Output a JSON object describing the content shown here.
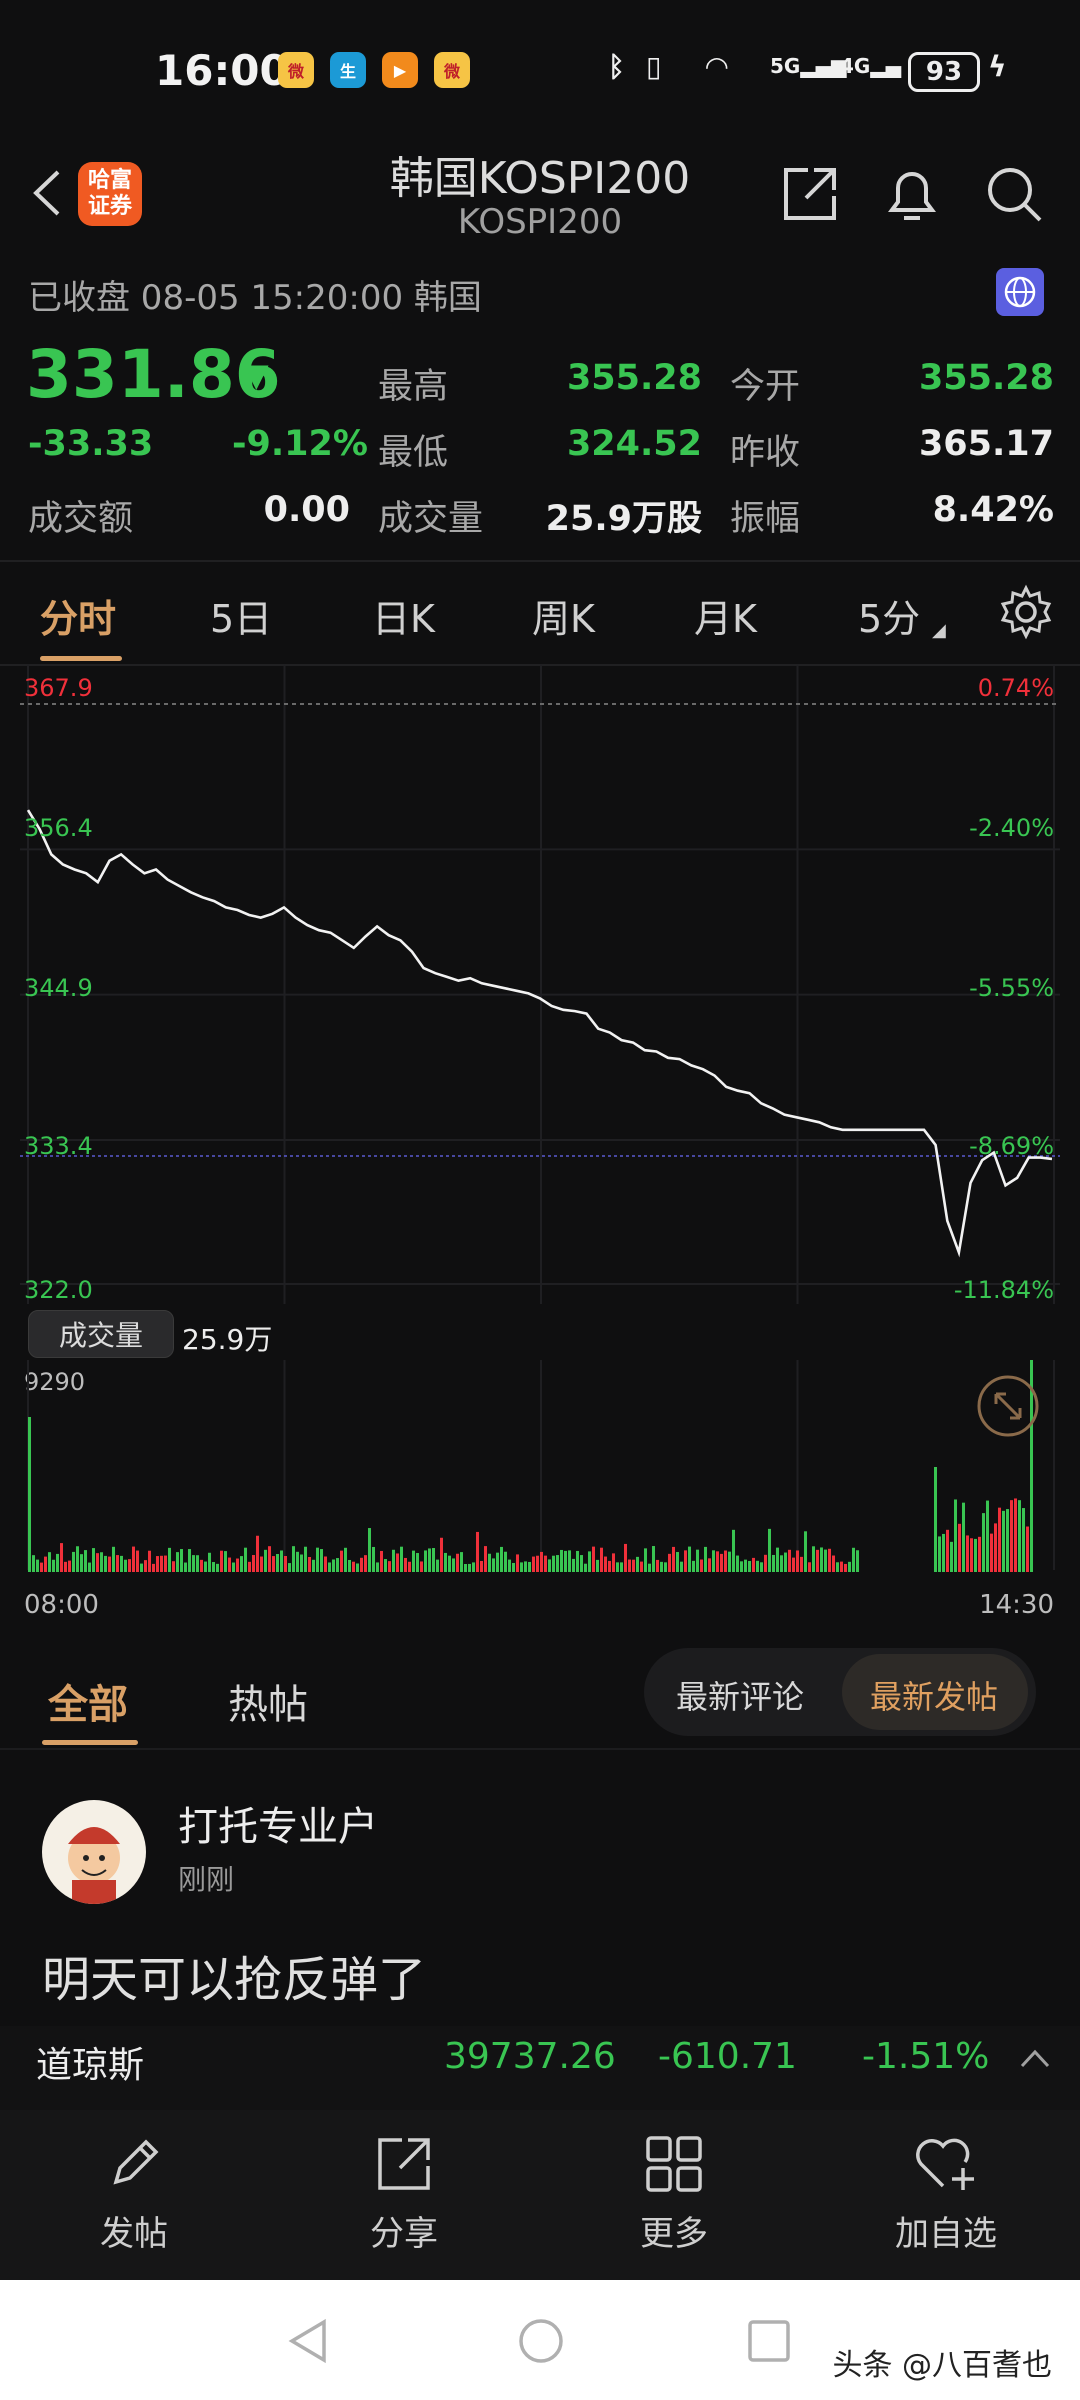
{
  "status_bar": {
    "time": "16:00",
    "network": "5G",
    "network2": "4G",
    "battery": "93"
  },
  "header": {
    "brand_line1": "哈富",
    "brand_line2": "证券",
    "title": "韩国KOSPI200",
    "subtitle": "KOSPI200"
  },
  "quote": {
    "status": "已收盘  08-05 15:20:00  韩国",
    "price": "331.86",
    "change": "-33.33",
    "change_pct": "-9.12%",
    "turnover_label": "成交额",
    "turnover": "0.00",
    "high_label": "最高",
    "high": "355.28",
    "low_label": "最低",
    "low": "324.52",
    "volume_label": "成交量",
    "volume": "25.9万股",
    "open_label": "今开",
    "open": "355.28",
    "prev_close_label": "昨收",
    "prev_close": "365.17",
    "amplitude_label": "振幅",
    "amplitude": "8.42%"
  },
  "chart_tabs": [
    "分时",
    "5日",
    "日K",
    "周K",
    "月K",
    "5分"
  ],
  "chart_data": {
    "type": "line",
    "title": "",
    "y_ticks_left": [
      "367.9",
      "356.4",
      "344.9",
      "333.4",
      "322.0"
    ],
    "y_ticks_right": [
      "0.74%",
      "-2.40%",
      "-5.55%",
      "-8.69%",
      "-11.84%"
    ],
    "ylim": [
      322.0,
      367.9
    ],
    "x_start": "08:00",
    "x_end": "14:30",
    "series": [
      {
        "values": [
          359.5,
          358.0,
          356.0,
          355.2,
          354.8,
          354.5,
          353.8,
          355.5,
          356.0,
          355.2,
          354.5,
          354.8,
          354.0,
          353.5,
          353.0,
          352.6,
          352.3,
          351.8,
          351.6,
          351.2,
          351.0,
          351.3,
          351.8,
          351.0,
          350.4,
          350.0,
          349.8,
          349.2,
          348.6,
          349.5,
          350.3,
          349.6,
          349.2,
          348.3,
          347.0,
          346.6,
          346.3,
          346.0,
          346.2,
          345.8,
          345.6,
          345.4,
          345.2,
          345.0,
          344.6,
          344.0,
          343.7,
          343.6,
          343.4,
          342.2,
          341.9,
          341.3,
          341.1,
          340.5,
          340.4,
          339.9,
          339.8,
          339.3,
          339.0,
          338.5,
          337.6,
          337.3,
          337.1,
          336.3,
          335.9,
          335.4,
          335.2,
          335.0,
          334.8,
          334.4,
          334.2,
          334.2,
          334.2,
          334.2,
          334.2,
          334.2,
          334.2,
          334.2,
          333.0,
          327.0,
          324.5,
          330.0,
          331.8,
          332.4,
          329.8,
          330.4,
          332.0,
          332.0,
          331.9
        ]
      }
    ],
    "volume_label": "成交量",
    "volume_total": "25.9万",
    "volume_max": "9290"
  },
  "discuss": {
    "tabs": [
      "全部",
      "热帖"
    ],
    "sort": [
      "最新评论",
      "最新发帖"
    ],
    "post": {
      "user": "打托专业户",
      "time": "刚刚",
      "text": "明天可以抢反弹了"
    }
  },
  "ticker": {
    "name": "道琼斯",
    "value": "39737.26",
    "change": "-610.71",
    "pct": "-1.51%"
  },
  "toolbar": [
    "发帖",
    "分享",
    "更多",
    "加自选"
  ],
  "watermark": "头条 @八百耆也"
}
